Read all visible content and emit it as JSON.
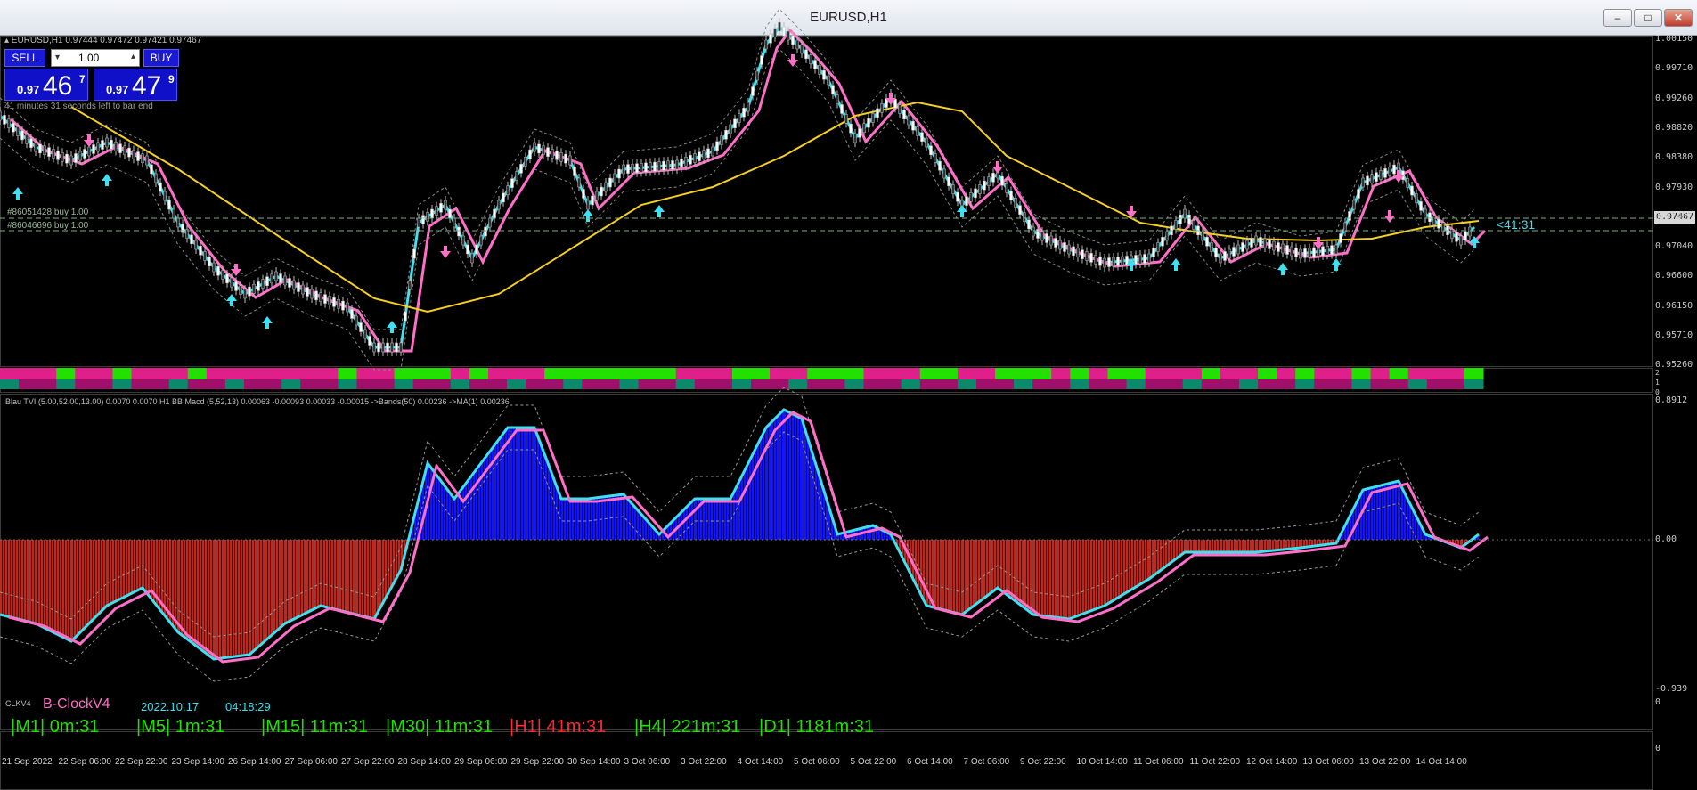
{
  "window": {
    "title": "EURUSD,H1",
    "buttons": {
      "minimize": "–",
      "maximize": "□",
      "close": "✕"
    }
  },
  "colors": {
    "bull_line": "#3fe0f0",
    "bear_line": "#ff6fc8",
    "ma_line": "#f5d020",
    "hist_pos": "#1414ff",
    "hist_neg": "#c0281e",
    "bar_green": "#22e000",
    "bar_magenta": "#e0208a"
  },
  "main_pane": {
    "symbol_info": "▴ EURUSD,H1  0.97444 0.97472 0.97421 0.97467",
    "bar_timer": "41 minutes 31 seconds left to bar end",
    "order1": "#86051428 buy 1.00",
    "order2": "#86046696 buy 1.00",
    "countdown": "<41:31",
    "current_price": "0.97467",
    "price_scale": [
      "1.00150",
      "0.99710",
      "0.99260",
      "0.98820",
      "0.98380",
      "0.97930",
      "0.97467",
      "0.97040",
      "0.96600",
      "0.96150",
      "0.95710",
      "0.95260"
    ]
  },
  "trade_panel": {
    "sell_label": "SELL",
    "buy_label": "BUY",
    "lot": "1.00",
    "sell_small": "0.97",
    "sell_big": "46",
    "sell_sup": "7",
    "buy_small": "0.97",
    "buy_big": "47",
    "buy_sup": "9"
  },
  "strip_pane": {
    "scale": [
      "2",
      "1",
      "0"
    ]
  },
  "macd_pane": {
    "info": "Blau TVI (5.00,52.00,13.00) 0.0070 0.0070  H1 BB Macd (5,52,13) 0.00063 -0.00093 0.00033 -0.00015  ->Bands(50) 0.00236  ->MA(1) 0.00236",
    "scale": [
      "0.8912",
      "0.00",
      "-0.939"
    ]
  },
  "clock_pane": {
    "name": "CLKV4",
    "title": "B-ClockV4",
    "date": "2022.10.17",
    "time": "04:18:29",
    "scale": [
      "0",
      "0"
    ],
    "timeframes": [
      {
        "label": "|M1| 0m:31",
        "color": "#22e000"
      },
      {
        "label": "|M5| 1m:31",
        "color": "#22e000"
      },
      {
        "label": "|M15| 11m:31",
        "color": "#22e000"
      },
      {
        "label": "|M30| 11m:31",
        "color": "#22e000"
      },
      {
        "label": "|H1| 41m:31",
        "color": "#ff2a2a"
      },
      {
        "label": "|H4| 221m:31",
        "color": "#22e000"
      },
      {
        "label": "|D1| 1181m:31",
        "color": "#22e000"
      }
    ]
  },
  "x_axis": [
    "21 Sep 2022",
    "22 Sep 06:00",
    "22 Sep 22:00",
    "23 Sep 14:00",
    "26 Sep 14:00",
    "27 Sep 06:00",
    "27 Sep 22:00",
    "28 Sep 14:00",
    "29 Sep 06:00",
    "29 Sep 22:00",
    "30 Sep 14:00",
    "3 Oct 06:00",
    "3 Oct 22:00",
    "4 Oct 14:00",
    "5 Oct 06:00",
    "5 Oct 22:00",
    "6 Oct 14:00",
    "7 Oct 06:00",
    "9 Oct 22:00",
    "10 Oct 14:00",
    "11 Oct 06:00",
    "11 Oct 22:00",
    "12 Oct 14:00",
    "13 Oct 06:00",
    "13 Oct 22:00",
    "14 Oct 14:00"
  ]
}
